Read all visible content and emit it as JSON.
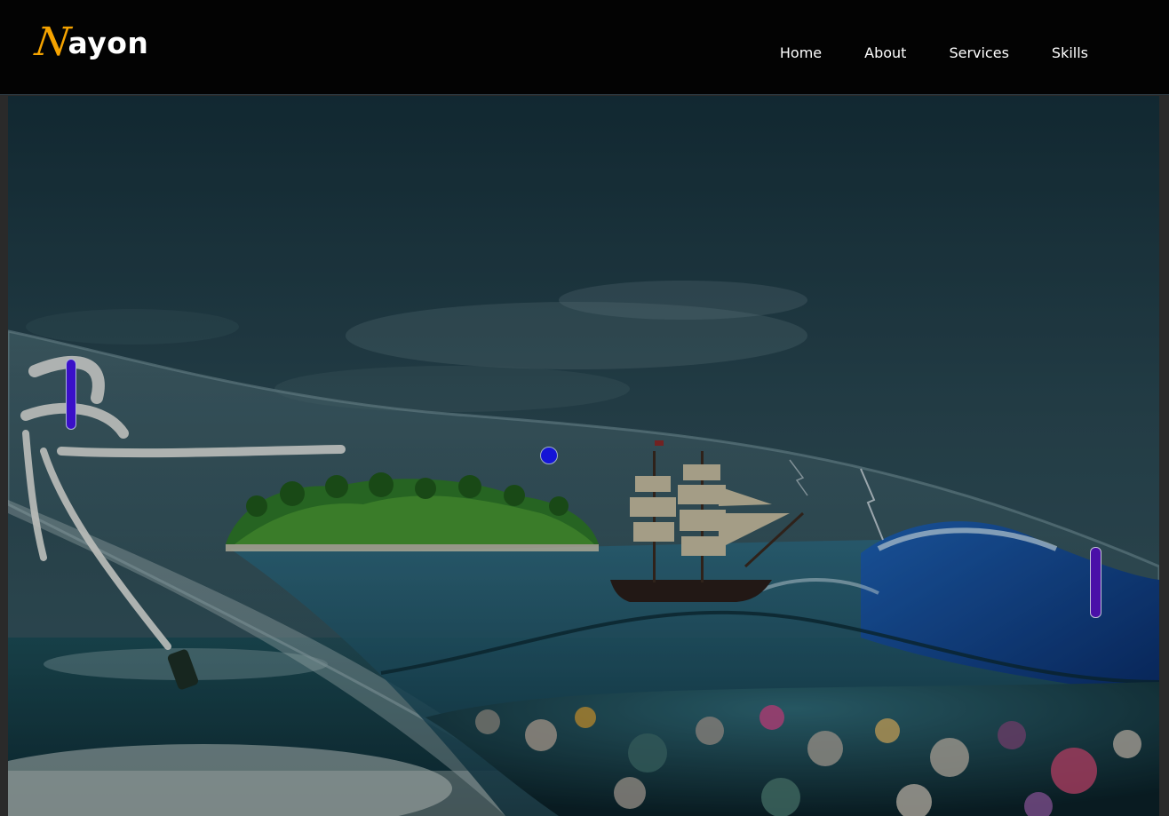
{
  "brand": {
    "mark": "N",
    "name": "ayon",
    "mark_color": "#f5a300"
  },
  "nav": {
    "items": [
      {
        "label": "Home"
      },
      {
        "label": "About"
      },
      {
        "label": "Services"
      },
      {
        "label": "Skills"
      }
    ]
  },
  "hero": {
    "image": "ship-in-bottle-scene",
    "overlay_color": "#000000"
  },
  "decor": {
    "center_dot_color": "#1414d6",
    "left_pill_color": "#3a10c8",
    "right_pill_color": "#4a10a8"
  }
}
